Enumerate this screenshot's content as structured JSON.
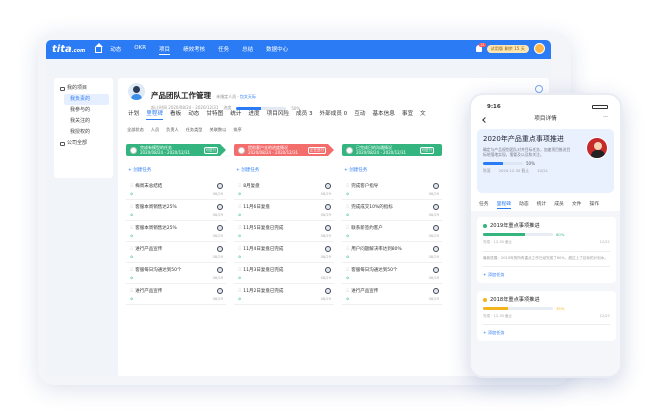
{
  "topbar": {
    "logo": "tita",
    "logo_suffix": ".com",
    "nav": [
      "动态",
      "OKR",
      "项目",
      "绩效考核",
      "任务",
      "总结",
      "数据中心"
    ],
    "active": "项目",
    "notif_count": "12",
    "trial": "试用版 剩余 15 天"
  },
  "sidebar": {
    "items": [
      {
        "label": "我的项目",
        "kind": "header"
      },
      {
        "label": "我负责的",
        "kind": "active"
      },
      {
        "label": "我参与的",
        "kind": "sub"
      },
      {
        "label": "我关注的",
        "kind": "sub"
      },
      {
        "label": "我授权的",
        "kind": "sub"
      },
      {
        "label": "公司全部",
        "kind": "header"
      }
    ]
  },
  "project": {
    "title": "产品团队工作管理",
    "leader_label": "未指定人员 · ",
    "leader": "包文天际",
    "time": "起止时间 2020/08/24 - 2020/12/31",
    "progress_label": "进度",
    "progress_value": "50%"
  },
  "tabs": [
    "计划",
    "里程碑",
    "看板",
    "动态",
    "甘特图",
    "统计",
    "进度",
    "项目风险",
    "成员 3",
    "外部成员 0",
    "互动",
    "基本信息",
    "事宜",
    "文"
  ],
  "active_tab": "里程碑",
  "filters": [
    "全部状态",
    "人员",
    "负责人",
    "任务类型",
    "关联数以",
    "排序"
  ],
  "add_task": "+ 创建任务",
  "columns": [
    {
      "title": "完成有模型的任务",
      "date": "2020/08/24 - 2020/12/31",
      "tag": "可进行",
      "color": "#34b57f",
      "cards": [
        {
          "title": "梅周末总结结",
          "date": "08/29"
        },
        {
          "title": "客服本周销售达25%",
          "date": "08/29"
        },
        {
          "title": "客服本周销售达25%",
          "date": "08/29"
        },
        {
          "title": "进行产品宣传",
          "date": "08/29"
        },
        {
          "title": "客服每日沟通达到50个",
          "date": "08/29"
        },
        {
          "title": "进行产品宣传",
          "date": "08/29"
        }
      ]
    },
    {
      "title": "提前客户支的进度情况",
      "date": "2020/08/24 - 2020/12/31",
      "tag": "正在进行",
      "color": "#f36d6d",
      "cards": [
        {
          "title": "8月复盘",
          "date": "08/29"
        },
        {
          "title": "11月6日复盘",
          "date": "08/29"
        },
        {
          "title": "11月5日复盘已完成",
          "date": "08/29"
        },
        {
          "title": "11月4日复盘已完成",
          "date": "08/29"
        },
        {
          "title": "11月3日复盘已完成",
          "date": "08/29"
        },
        {
          "title": "11月2日复盘已完成",
          "date": "08/29"
        }
      ]
    },
    {
      "title": "已完成日的沟通情况",
      "date": "2020/08/24 - 2020/12/31",
      "tag": "可进行",
      "color": "#34b57f",
      "cards": [
        {
          "title": "完成客户指导",
          "date": "08/29"
        },
        {
          "title": "完成成交10%的指标",
          "date": "08/29"
        },
        {
          "title": "联系新签约客户",
          "date": "08/29"
        },
        {
          "title": "用户问题解决率达到80%",
          "date": "08/29"
        },
        {
          "title": "客服每日沟通达到50个",
          "date": "08/29"
        },
        {
          "title": "进行产品宣传",
          "date": "08/29"
        }
      ]
    }
  ],
  "phone": {
    "time": "9:16",
    "title": "项目详情",
    "hero_title": "2020年产品重点事项推进",
    "hero_sub": "确定与产品规划团队对齐目标任务，加速项目推进目标地落地实现，需要及以及和关注。",
    "hero_progress": "50%",
    "hero_owner": "陈斐",
    "hero_date": "2020.12.30 截止",
    "hero_count": "10/21",
    "tabs": [
      "任务",
      "里程碑",
      "动态",
      "统计",
      "成员",
      "文件",
      "操作"
    ],
    "active_tab": "里程碑",
    "groups": [
      {
        "title": "2019年重点事项推进",
        "progress": "60%",
        "pct": 60,
        "color": "#34b57f",
        "meta_left": "完成 · 12.30 截止",
        "meta_right": "12/21",
        "note": "最新进展：2019年的所有重点工作已经完成了60%，超过上了目标的计划水。",
        "add": "+ 添加任务"
      },
      {
        "title": "2018年重点事项推进",
        "progress": "35%",
        "pct": 35,
        "color": "#f3b41d",
        "meta_left": "完成 · 12.30 截止",
        "meta_right": "12/21",
        "add": "+ 添加任务"
      }
    ]
  }
}
